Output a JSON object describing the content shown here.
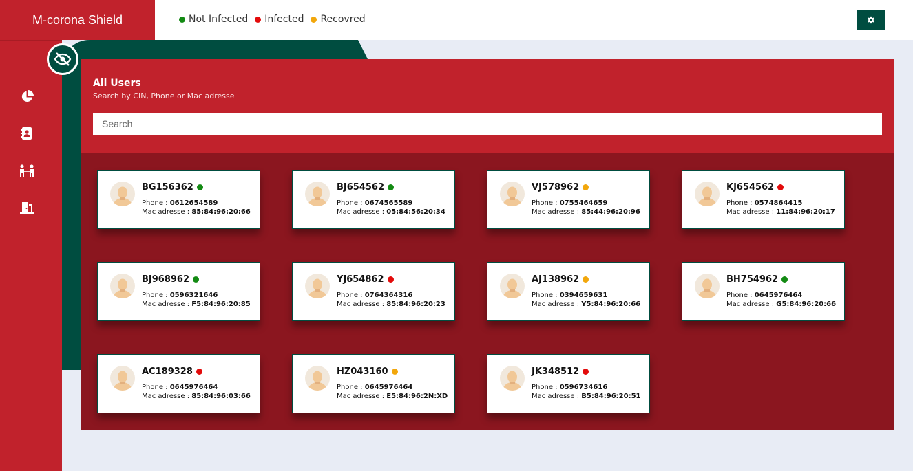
{
  "app": {
    "title": "M-corona Shield"
  },
  "legend": [
    {
      "label": "Not Infected",
      "color": "#138a13"
    },
    {
      "label": "Infected",
      "color": "#e30b0b"
    },
    {
      "label": "Recovred",
      "color": "#f2a70c"
    }
  ],
  "header": {
    "settings_icon": "gear-icon"
  },
  "sidebar": {
    "items": [
      {
        "icon": "pie-chart-icon"
      },
      {
        "icon": "contact-book-icon"
      },
      {
        "icon": "people-icon"
      },
      {
        "icon": "logout-door-icon"
      }
    ],
    "toggle_icon": "eye-slash-icon"
  },
  "panel": {
    "title": "All Users",
    "subtitle": "Search by CIN, Phone or Mac adresse",
    "search_placeholder": "Search"
  },
  "labels": {
    "phone": "Phone : ",
    "mac": "Mac adresse : "
  },
  "users": [
    {
      "cin": "BG156362",
      "status": "not_infected",
      "phone": "0612654589",
      "mac": "85:84:96:20:66"
    },
    {
      "cin": "BJ654562",
      "status": "not_infected",
      "phone": "0674565589",
      "mac": "05:84:56:20:34"
    },
    {
      "cin": "VJ578962",
      "status": "recovered",
      "phone": "0755464659",
      "mac": "85:44:96:20:96"
    },
    {
      "cin": "KJ654562",
      "status": "infected",
      "phone": "0574864415",
      "mac": "11:84:96:20:17"
    },
    {
      "cin": "BJ968962",
      "status": "not_infected",
      "phone": "0596321646",
      "mac": "F5:84:96:20:85"
    },
    {
      "cin": "YJ654862",
      "status": "infected",
      "phone": "0764364316",
      "mac": "85:84:96:20:23"
    },
    {
      "cin": "AJ138962",
      "status": "recovered",
      "phone": "0394659631",
      "mac": "Y5:84:96:20:66"
    },
    {
      "cin": "BH754962",
      "status": "not_infected",
      "phone": "0645976464",
      "mac": "G5:84:96:20:66"
    },
    {
      "cin": "AC189328",
      "status": "infected",
      "phone": "0645976464",
      "mac": "85:84:96:03:66"
    },
    {
      "cin": "HZ043160",
      "status": "recovered",
      "phone": "0645976464",
      "mac": "E5:84:96:2N:XD"
    },
    {
      "cin": "JK348512",
      "status": "infected",
      "phone": "0596734616",
      "mac": "B5:84:96:20:51"
    }
  ],
  "status_colors": {
    "not_infected": "#138a13",
    "infected": "#e30b0b",
    "recovered": "#f2a70c"
  }
}
